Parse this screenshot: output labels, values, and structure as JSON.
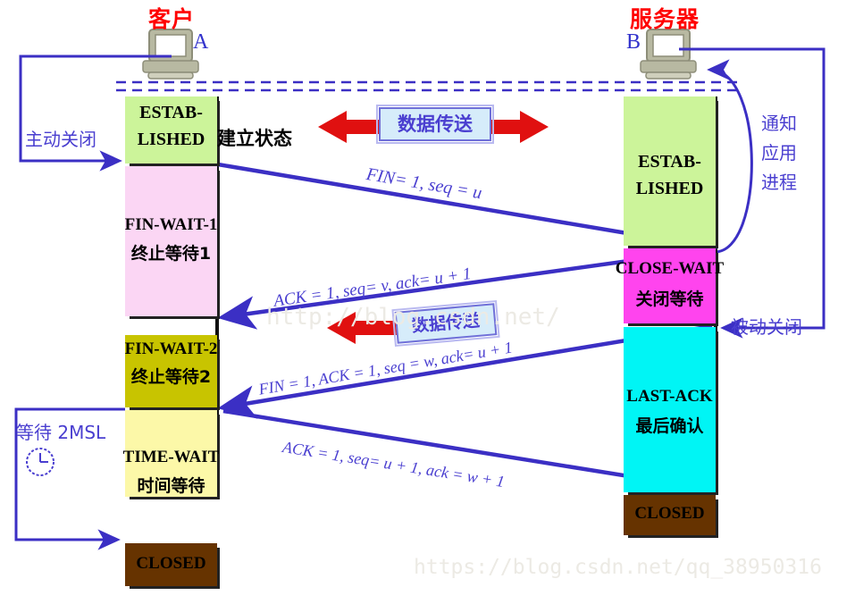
{
  "hosts": {
    "client": {
      "title": "客户",
      "letter": "A",
      "icon": "computer-icon"
    },
    "server": {
      "title": "服务器",
      "letter": "B",
      "icon": "computer-icon"
    }
  },
  "client_states": [
    {
      "en": "ESTAB-",
      "en2": "LISHED",
      "cn": "",
      "color": "#ccf49a",
      "name": "established"
    },
    {
      "en": "FIN-WAIT-1",
      "en2": "",
      "cn": "终止等待1",
      "color": "#fbd6f4",
      "name": "fin-wait-1"
    },
    {
      "en": "FIN-WAIT-2",
      "en2": "",
      "cn": "终止等待2",
      "color": "#c8c400",
      "name": "fin-wait-2"
    },
    {
      "en": "TIME-WAIT",
      "en2": "",
      "cn": "时间等待",
      "color": "#fcf8a8",
      "name": "time-wait"
    },
    {
      "en": "CLOSED",
      "en2": "",
      "cn": "",
      "color": "#663300",
      "name": "closed"
    }
  ],
  "server_states": [
    {
      "en": "ESTAB-",
      "en2": "LISHED",
      "cn": "",
      "color": "#ccf49a",
      "name": "established"
    },
    {
      "en": "CLOSE-WAIT",
      "en2": "",
      "cn": "关闭等待",
      "color": "#ff44ee",
      "name": "close-wait"
    },
    {
      "en": "LAST-ACK",
      "en2": "",
      "cn": "最后确认",
      "color": "#00f5f5",
      "name": "last-ack"
    },
    {
      "en": "CLOSED",
      "en2": "",
      "cn": "",
      "color": "#663300",
      "name": "closed"
    }
  ],
  "annotations": {
    "established_cn": "建立状态",
    "active_close": "主动关闭",
    "passive_close": "被动关闭",
    "notify_app": [
      "通知",
      "应用",
      "进程"
    ],
    "wait_2msl": "等待 2MSL",
    "clock_icon": "clock-icon"
  },
  "data_transfer": {
    "top_label": "数据传送",
    "mid_label": "数据传送"
  },
  "segments": [
    {
      "id": "fin-u",
      "text": "FIN= 1, seq = u"
    },
    {
      "id": "ack-v",
      "text": "ACK = 1, seq= v, ack= u + 1"
    },
    {
      "id": "fin-ack-w",
      "text": "FIN = 1, ACK = 1, seq = w, ack= u + 1"
    },
    {
      "id": "ack-final",
      "text": "ACK = 1, seq= u + 1, ack = w + 1"
    }
  ],
  "watermarks": {
    "middle": "http://blog.csdn.net/",
    "bottom": "https://blog.csdn.net/qq_38950316"
  },
  "colors": {
    "arrow_purple": "#3b2fc4",
    "arrow_red": "#e01010",
    "host_label_red": "#ff0000",
    "text_purple": "#4a3fd0"
  }
}
